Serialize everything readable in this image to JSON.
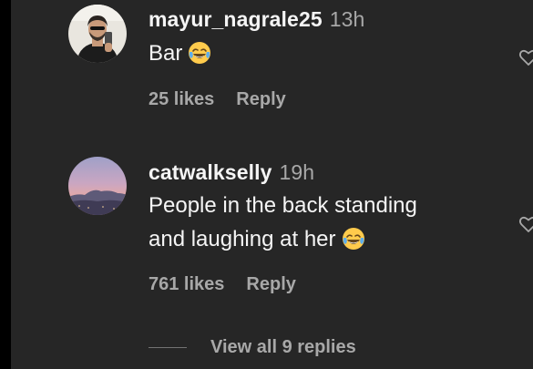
{
  "comments": [
    {
      "username": "mayur_nagrale25",
      "time": "13h",
      "text": "Bar",
      "emoji": "face-with-tears-of-joy",
      "likes": "25 likes",
      "reply_label": "Reply"
    },
    {
      "username": "catwalkselly",
      "time": "19h",
      "text_line1": "People in the back standing",
      "text_line2": "and laughing at her",
      "emoji": "face-with-tears-of-joy",
      "likes": "761 likes",
      "reply_label": "Reply"
    }
  ],
  "view_replies": "View all 9 replies",
  "icons": {
    "like": "heart-icon"
  },
  "colors": {
    "background": "#262626",
    "primary_text": "#f5f5f5",
    "secondary_text": "#a8a8a8"
  }
}
